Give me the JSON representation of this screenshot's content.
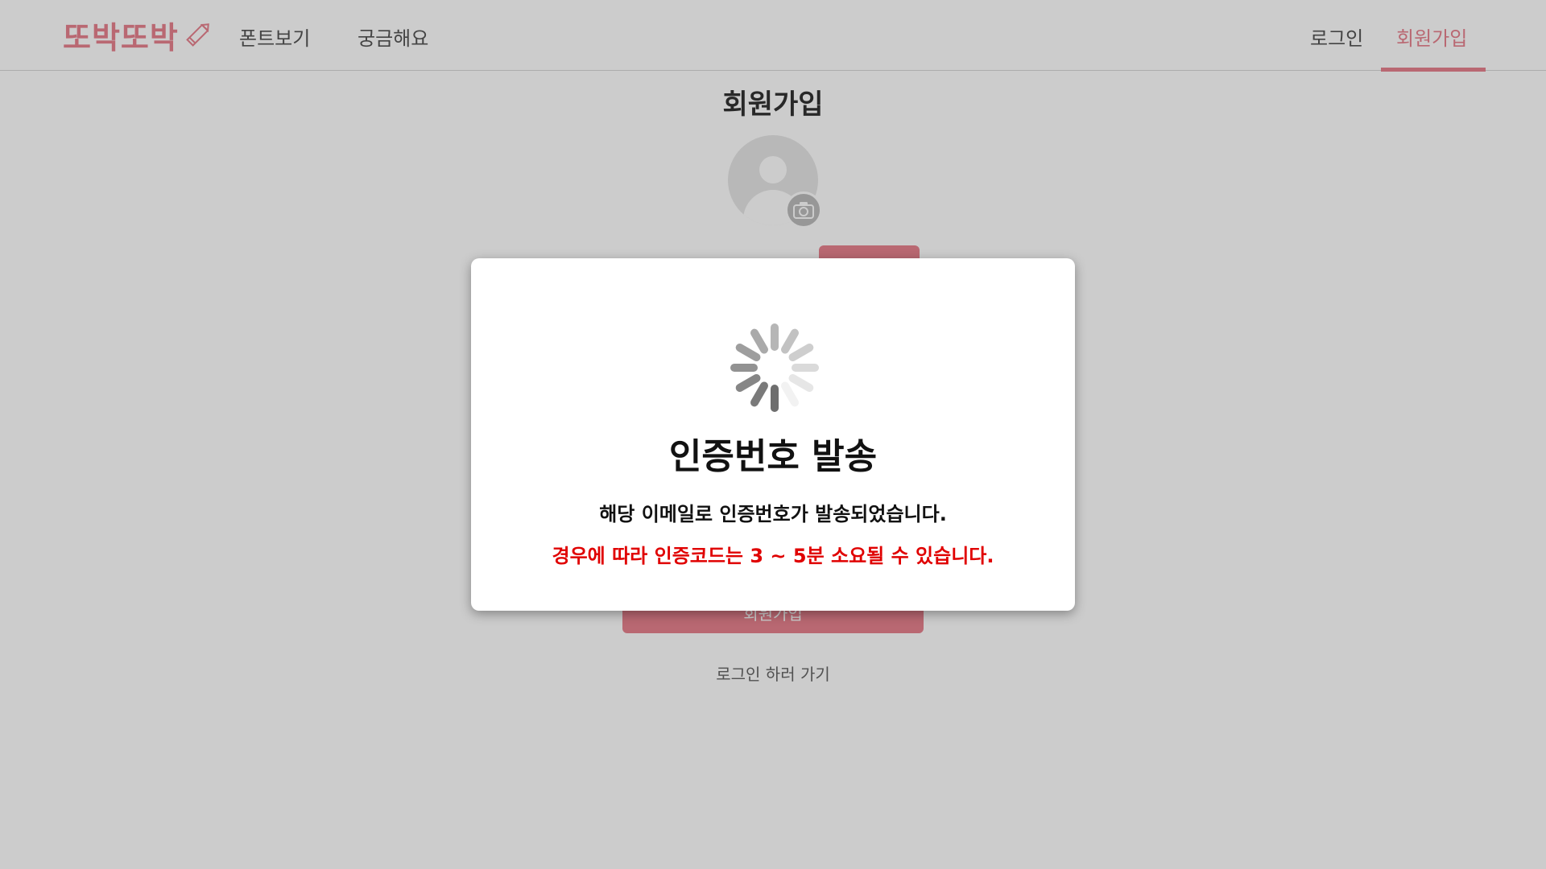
{
  "header": {
    "logo": "또박또박",
    "nav": {
      "fonts": "폰트보기",
      "faq": "궁금해요",
      "login": "로그인",
      "signup": "회원가입"
    }
  },
  "page": {
    "title": "회원가입",
    "submit_label": "회원가입",
    "login_link": "로그인 하러 가기"
  },
  "modal": {
    "title": "인증번호 발송",
    "message": "해당 이메일로 인증번호가 발송되었습니다.",
    "note": "경우에 따라 인증코드는 3 ~ 5분 소요될 수 있습니다."
  },
  "colors": {
    "accent": "#e8828f",
    "warning": "#e00000"
  },
  "icons": [
    "pencil-icon",
    "avatar-icon",
    "camera-icon",
    "loading-spinner-icon"
  ]
}
